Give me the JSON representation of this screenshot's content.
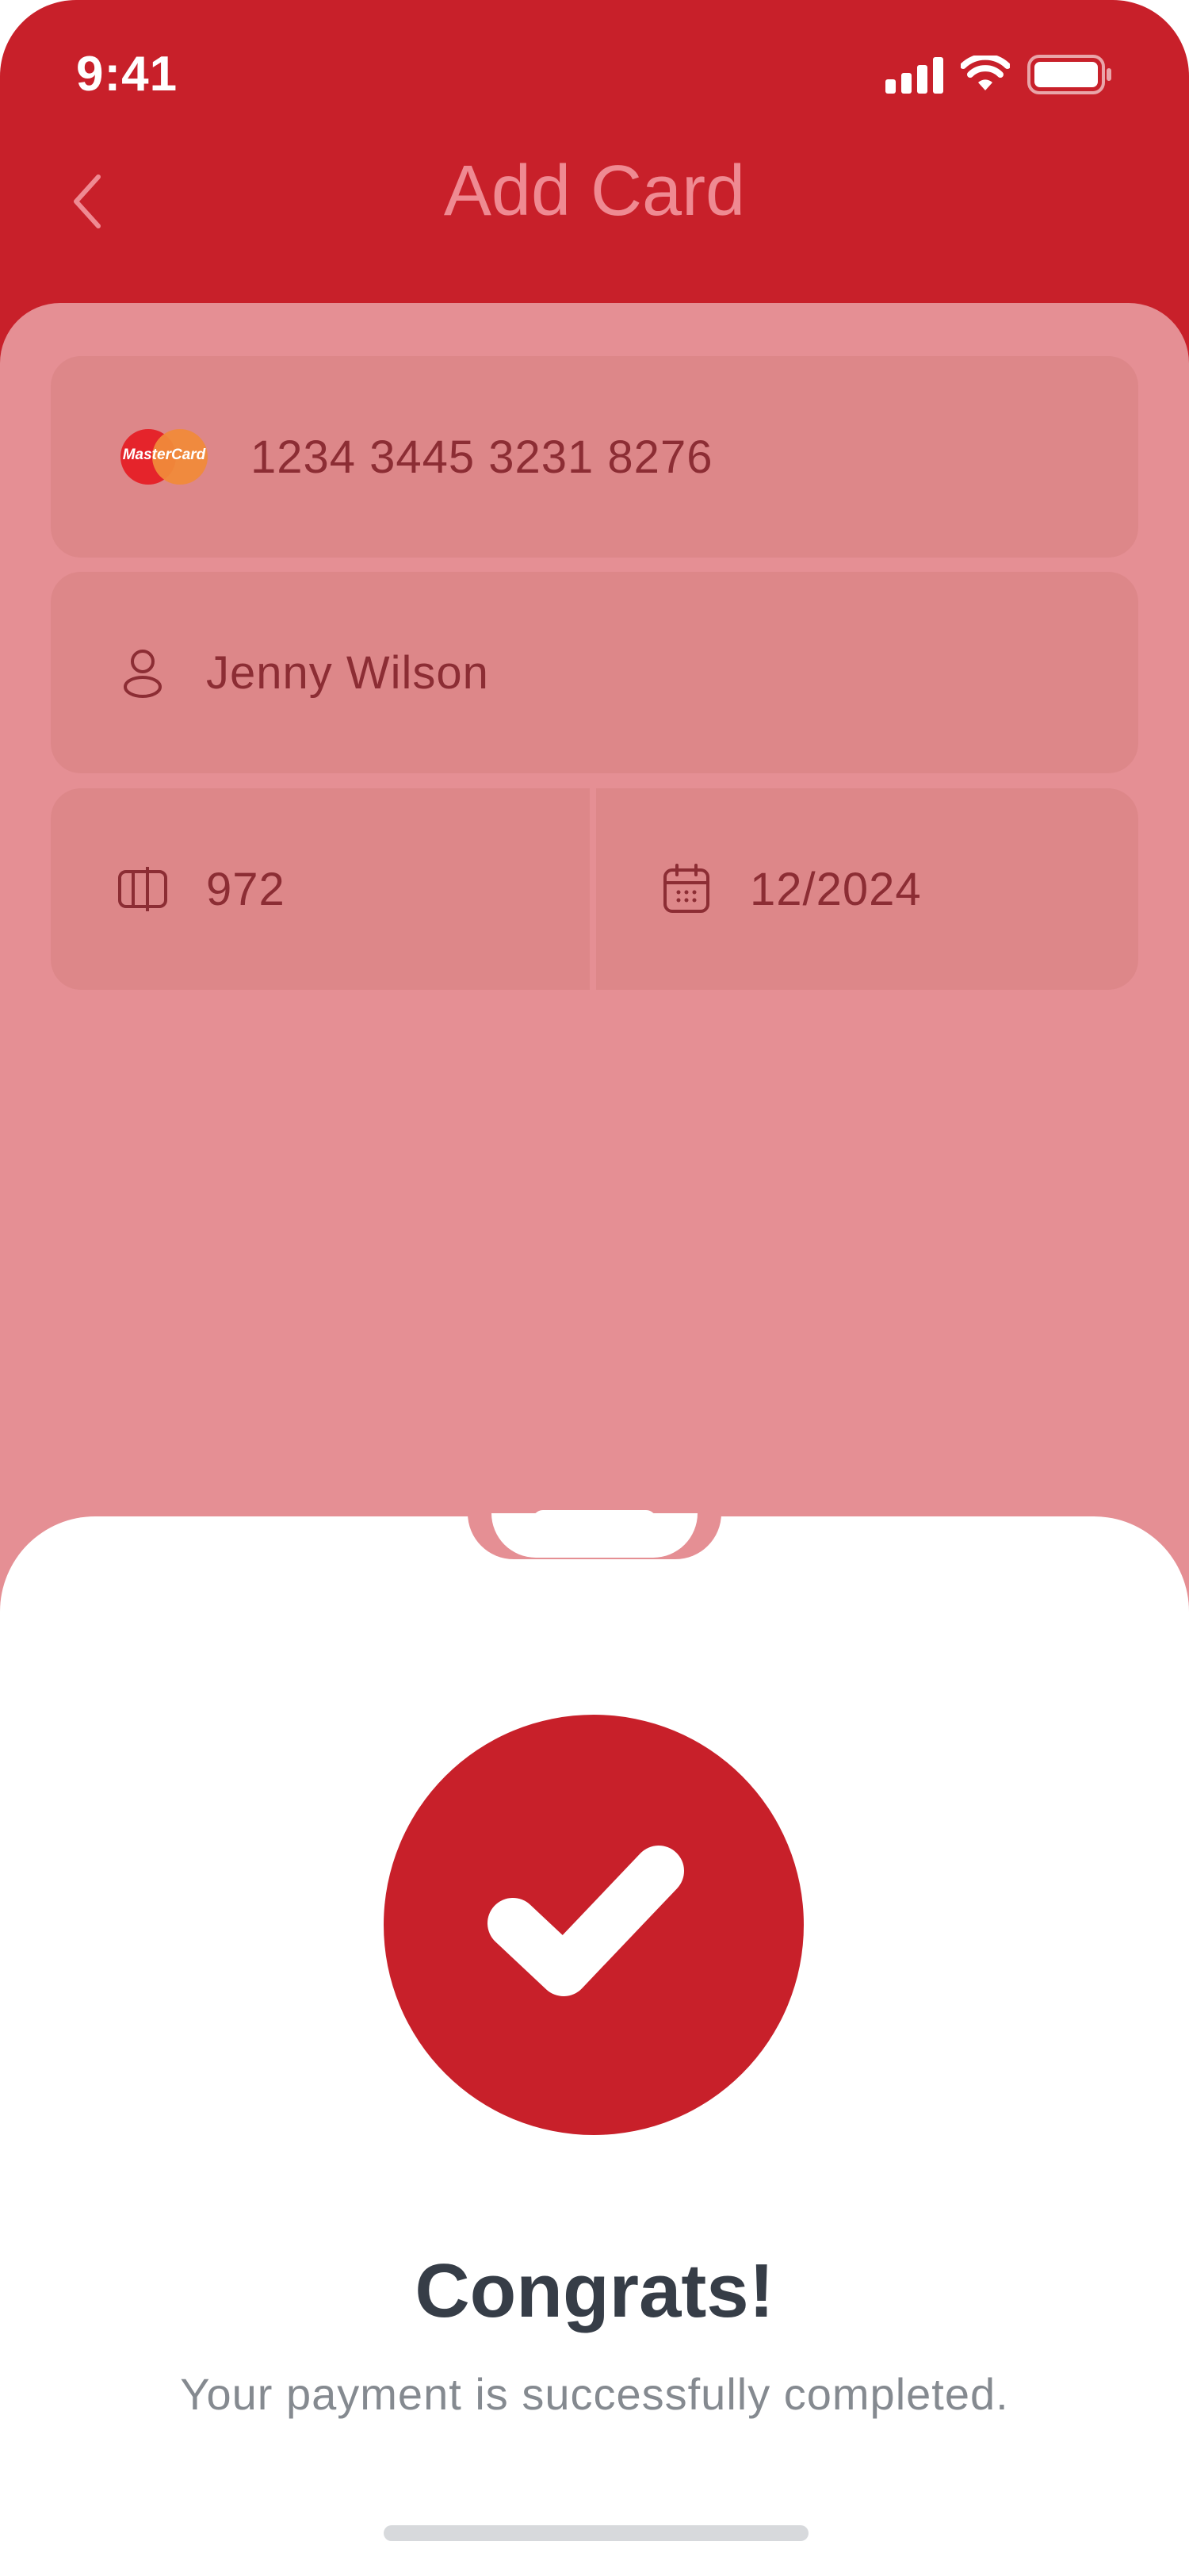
{
  "status_bar": {
    "time": "9:41",
    "icons": [
      "signal-icon",
      "wifi-icon",
      "battery-icon"
    ]
  },
  "nav": {
    "title": "Add Card",
    "back_icon": "chevron-left-icon"
  },
  "form": {
    "card_number": "1234 3445 3231 8276",
    "card_brand": "MasterCard",
    "card_holder": "Jenny Wilson",
    "cvv": "972",
    "expiry": "12/2024"
  },
  "sheet": {
    "title": "Congrats!",
    "message": "Your payment is successfully completed.",
    "status_icon": "checkmark-icon"
  },
  "colors": {
    "primary": "#c8202a",
    "dimmed_panel": "#e58f94",
    "title_text": "#363d47",
    "body_text": "#858a90"
  }
}
